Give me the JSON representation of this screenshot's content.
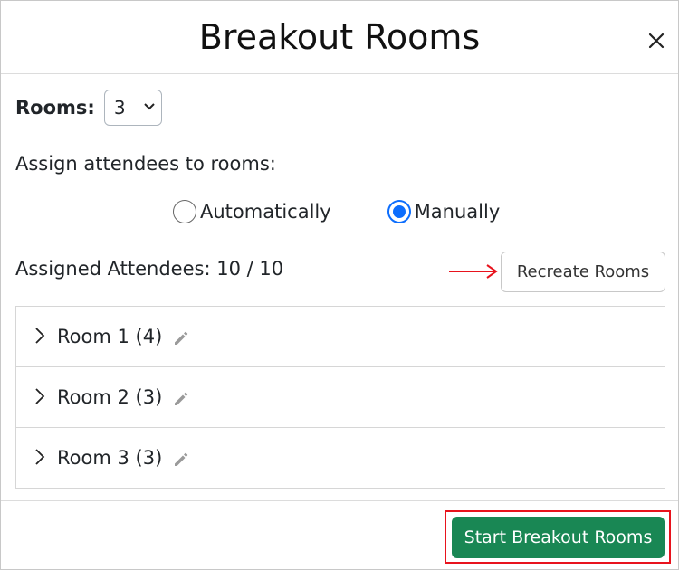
{
  "header": {
    "title": "Breakout Rooms",
    "close_icon": "close-icon"
  },
  "rooms": {
    "label": "Rooms:",
    "selected_value": "3"
  },
  "assign": {
    "label": "Assign attendees to rooms:",
    "options": [
      {
        "label": "Automatically",
        "checked": false
      },
      {
        "label": "Manually",
        "checked": true
      }
    ]
  },
  "assigned": {
    "label": "Assigned Attendees: 10 / 10",
    "recreate_label": "Recreate Rooms"
  },
  "room_list": [
    {
      "label": "Room 1 (4)"
    },
    {
      "label": "Room 2 (3)"
    },
    {
      "label": "Room 3 (3)"
    }
  ],
  "footer": {
    "start_label": "Start Breakout Rooms"
  },
  "colors": {
    "accent_blue": "#0d6efd",
    "start_green": "#198754",
    "highlight_red": "#e8131d"
  }
}
